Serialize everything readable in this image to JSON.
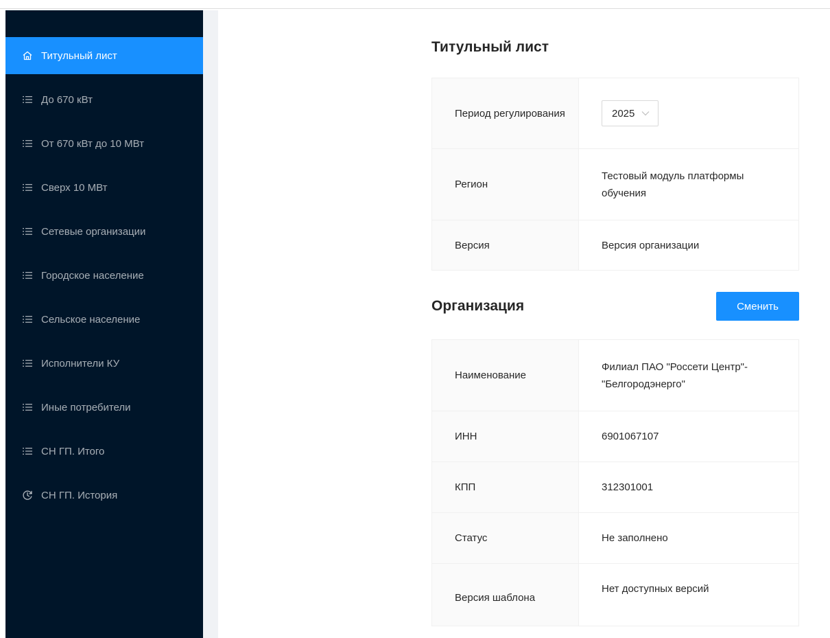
{
  "sidebar": {
    "items": [
      {
        "label": "Титульный лист",
        "icon": "home-icon",
        "active": true
      },
      {
        "label": "До 670 кВт",
        "icon": "list-icon",
        "active": false
      },
      {
        "label": "От 670 кВт до 10 МВт",
        "icon": "list-icon",
        "active": false
      },
      {
        "label": "Сверх 10 МВт",
        "icon": "list-icon",
        "active": false
      },
      {
        "label": "Сетевые организации",
        "icon": "list-icon",
        "active": false
      },
      {
        "label": "Городское население",
        "icon": "list-icon",
        "active": false
      },
      {
        "label": "Сельское население",
        "icon": "list-icon",
        "active": false
      },
      {
        "label": "Исполнители КУ",
        "icon": "list-icon",
        "active": false
      },
      {
        "label": "Иные потребители",
        "icon": "list-icon",
        "active": false
      },
      {
        "label": "СН ГП. Итого",
        "icon": "list-icon",
        "active": false
      },
      {
        "label": "СН ГП. История",
        "icon": "history-icon",
        "active": false
      }
    ]
  },
  "title_section": {
    "title": "Титульный лист",
    "period_label": "Период регулирования",
    "period_value": "2025",
    "region_label": "Регион",
    "region_value": "Тестовый модуль платформы обучения",
    "version_label": "Версия",
    "version_value": "Версия организации"
  },
  "org_section": {
    "title": "Организация",
    "change_button": "Сменить",
    "rows": [
      {
        "label": "Наименование",
        "value": "Филиал ПАО \"Россети Центр\"-\"Белгородэнерго\""
      },
      {
        "label": "ИНН",
        "value": "6901067107"
      },
      {
        "label": "КПП",
        "value": "312301001"
      },
      {
        "label": "Статус",
        "value": "Не заполнено"
      },
      {
        "label": "Версия шаблона",
        "value": "Нет доступных версий"
      }
    ]
  },
  "colors": {
    "sidebar_bg": "#001529",
    "accent": "#1890ff",
    "label_bg": "#fafafa"
  }
}
